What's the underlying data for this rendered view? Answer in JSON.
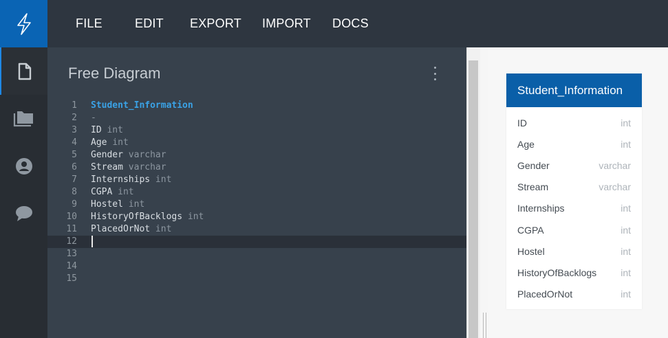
{
  "menu": [
    "FILE",
    "EDIT",
    "EXPORT",
    "IMPORT",
    "DOCS"
  ],
  "sidebar": {
    "items": [
      {
        "icon": "document-icon",
        "active": true
      },
      {
        "icon": "folder-icon",
        "active": false
      },
      {
        "icon": "user-icon",
        "active": false
      },
      {
        "icon": "chat-icon",
        "active": false
      }
    ]
  },
  "editor": {
    "title": "Free Diagram",
    "current_line": 12,
    "lines": [
      {
        "num": "1",
        "name": "Student_Information",
        "type": "",
        "kind": "table"
      },
      {
        "num": "2",
        "name": "-",
        "type": "",
        "kind": "dash"
      },
      {
        "num": "3",
        "name": "ID",
        "type": "int",
        "kind": "field"
      },
      {
        "num": "4",
        "name": "Age",
        "type": "int",
        "kind": "field"
      },
      {
        "num": "5",
        "name": "Gender",
        "type": "varchar",
        "kind": "field"
      },
      {
        "num": "6",
        "name": "Stream",
        "type": "varchar",
        "kind": "field"
      },
      {
        "num": "7",
        "name": "Internships",
        "type": "int",
        "kind": "field"
      },
      {
        "num": "8",
        "name": "CGPA",
        "type": "int",
        "kind": "field"
      },
      {
        "num": "9",
        "name": "Hostel",
        "type": "int",
        "kind": "field"
      },
      {
        "num": "10",
        "name": "HistoryOfBacklogs",
        "type": "int",
        "kind": "field"
      },
      {
        "num": "11",
        "name": "PlacedOrNot",
        "type": "int",
        "kind": "field"
      },
      {
        "num": "12",
        "name": "",
        "type": "",
        "kind": "empty"
      },
      {
        "num": "13",
        "name": "",
        "type": "",
        "kind": "empty"
      },
      {
        "num": "14",
        "name": "",
        "type": "",
        "kind": "empty"
      },
      {
        "num": "15",
        "name": "",
        "type": "",
        "kind": "empty"
      }
    ]
  },
  "diagram": {
    "table_name": "Student_Information",
    "fields": [
      {
        "name": "ID",
        "type": "int"
      },
      {
        "name": "Age",
        "type": "int"
      },
      {
        "name": "Gender",
        "type": "varchar"
      },
      {
        "name": "Stream",
        "type": "varchar"
      },
      {
        "name": "Internships",
        "type": "int"
      },
      {
        "name": "CGPA",
        "type": "int"
      },
      {
        "name": "Hostel",
        "type": "int"
      },
      {
        "name": "HistoryOfBacklogs",
        "type": "int"
      },
      {
        "name": "PlacedOrNot",
        "type": "int"
      }
    ]
  },
  "colors": {
    "accent": "#0a64b4",
    "table_header": "#0a5fa8",
    "code_table_name": "#3aa2e6"
  }
}
